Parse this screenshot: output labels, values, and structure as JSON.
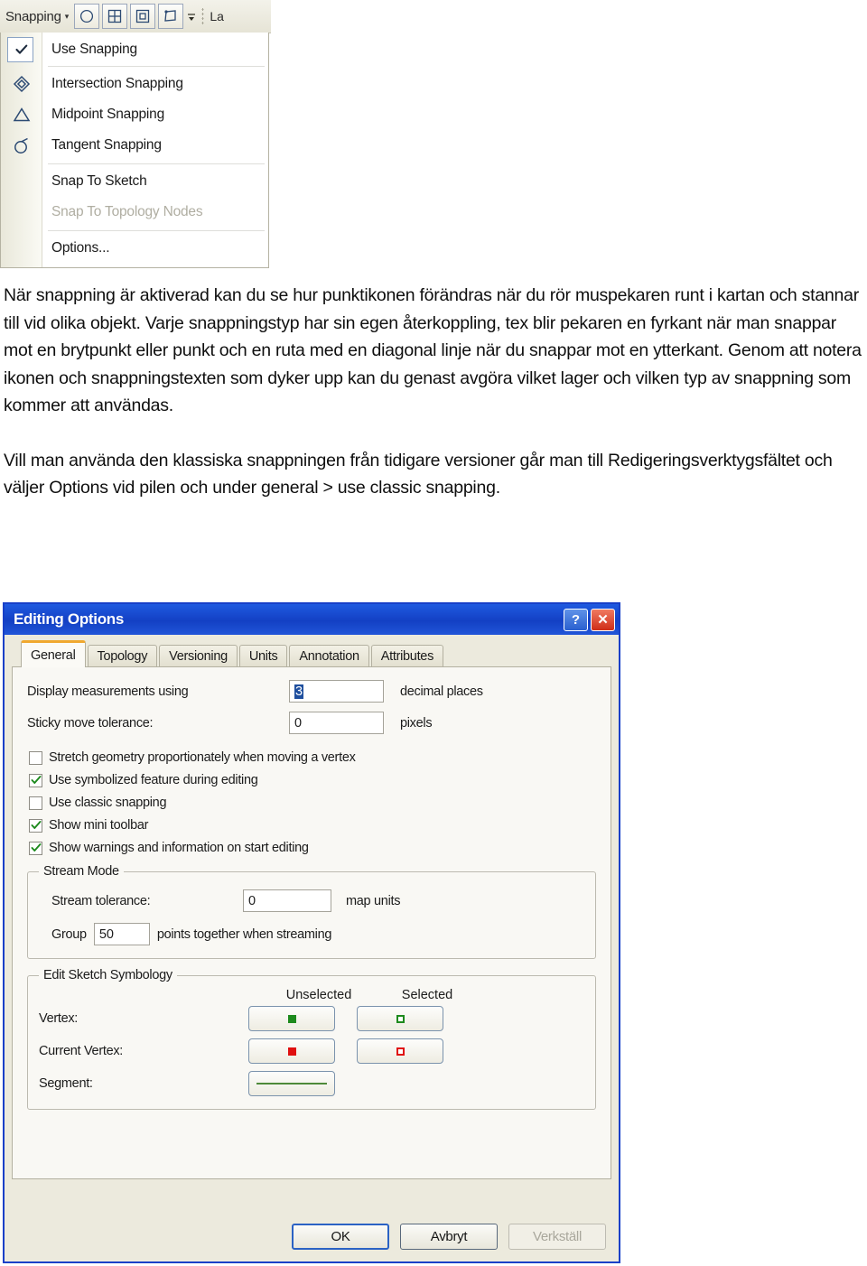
{
  "snapping_toolbar": {
    "menu_button_label": "Snapping",
    "caret": "▾",
    "tool_buttons": [
      {
        "name": "circle-snap-icon",
        "title": "Circle"
      },
      {
        "name": "grid-snap-icon",
        "title": "Grid"
      },
      {
        "name": "box-snap-icon",
        "title": "Box"
      },
      {
        "name": "polygon-snap-icon",
        "title": "Polygon"
      }
    ],
    "tail_label": "La"
  },
  "snapping_menu": {
    "items": [
      {
        "label": "Use Snapping",
        "icon": "check-icon",
        "checked": true,
        "disabled": false,
        "separator_after": true
      },
      {
        "label": "Intersection Snapping",
        "icon": "diamond-icon",
        "checked": false,
        "disabled": false,
        "separator_after": false
      },
      {
        "label": "Midpoint Snapping",
        "icon": "triangle-icon",
        "checked": false,
        "disabled": false,
        "separator_after": false
      },
      {
        "label": "Tangent Snapping",
        "icon": "tangent-circle-icon",
        "checked": false,
        "disabled": false,
        "separator_after": true
      },
      {
        "label": "Snap To Sketch",
        "icon": "",
        "checked": false,
        "disabled": false,
        "separator_after": false
      },
      {
        "label": "Snap To Topology Nodes",
        "icon": "",
        "checked": false,
        "disabled": true,
        "separator_after": true
      },
      {
        "label": "Options...",
        "icon": "",
        "checked": false,
        "disabled": false,
        "separator_after": false
      }
    ]
  },
  "document": {
    "paragraphs": [
      "När snappning är aktiverad kan du se hur punktikonen förändras när du rör muspekaren runt i kartan och stannar till vid olika objekt. Varje snappningstyp har sin egen återkoppling, tex blir pekaren en fyrkant när man snappar mot en brytpunkt eller punkt och en ruta med en diagonal linje när du snappar mot en ytterkant. Genom att notera ikonen och snappningstexten som dyker upp kan du genast avgöra vilket lager och vilken typ av snappning som kommer att användas.",
      "Vill man använda den klassiska snappningen från tidigare versioner går man till Redigeringsverktygsfältet och väljer Options vid pilen och under general > use classic snapping."
    ]
  },
  "dialog": {
    "title": "Editing Options",
    "title_buttons": {
      "help": "?",
      "close": "✕"
    },
    "tabs": [
      {
        "label": "General",
        "active": true
      },
      {
        "label": "Topology",
        "active": false
      },
      {
        "label": "Versioning",
        "active": false
      },
      {
        "label": "Units",
        "active": false
      },
      {
        "label": "Annotation",
        "active": false
      },
      {
        "label": "Attributes",
        "active": false
      }
    ],
    "general": {
      "fields": [
        {
          "label": "Display measurements using",
          "value": "3",
          "unit": "decimal places",
          "selected": true
        },
        {
          "label": "Sticky move tolerance:",
          "value": "0",
          "unit": "pixels",
          "selected": false
        }
      ],
      "checkboxes": [
        {
          "label": "Stretch geometry proportionately when moving a vertex",
          "checked": false
        },
        {
          "label": "Use symbolized feature during editing",
          "checked": true
        },
        {
          "label": "Use classic snapping",
          "checked": false
        },
        {
          "label": "Show mini toolbar",
          "checked": true
        },
        {
          "label": "Show warnings and information on start editing",
          "checked": true
        }
      ],
      "stream_mode": {
        "legend": "Stream Mode",
        "tolerance_label": "Stream tolerance:",
        "tolerance_value": "0",
        "tolerance_unit": "map units",
        "group_prefix": "Group",
        "group_value": "50",
        "group_suffix": "points together when streaming"
      },
      "edit_sketch_symbology": {
        "legend": "Edit Sketch Symbology",
        "column_headers": [
          "Unselected",
          "Selected"
        ],
        "rows": [
          {
            "label": "Vertex:",
            "unselected_color": "#1d8a1d",
            "unselected_filled": true,
            "selected_color": "#1d8a1d",
            "selected_filled": false,
            "has_selected": true
          },
          {
            "label": "Current Vertex:",
            "unselected_color": "#e01010",
            "unselected_filled": true,
            "selected_color": "#e01010",
            "selected_filled": false,
            "has_selected": true
          },
          {
            "label": "Segment:",
            "unselected_color": "#4e8a3a",
            "unselected_filled": true,
            "selected_color": "",
            "selected_filled": false,
            "has_selected": false
          }
        ]
      }
    },
    "buttons": [
      {
        "label": "OK",
        "style": "default",
        "disabled": false
      },
      {
        "label": "Avbryt",
        "style": "normal",
        "disabled": false
      },
      {
        "label": "Verkställ",
        "style": "normal",
        "disabled": true
      }
    ]
  },
  "colors": {
    "title_bar": "#1340c4",
    "active_tab_accent": "#f0a830",
    "close_button": "#cf2d18",
    "selection_blue": "#1f4f9e"
  }
}
